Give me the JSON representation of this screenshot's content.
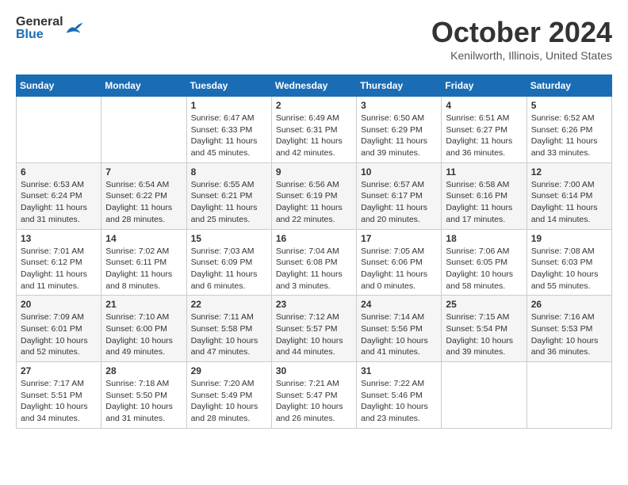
{
  "header": {
    "logo_general": "General",
    "logo_blue": "Blue",
    "month": "October 2024",
    "location": "Kenilworth, Illinois, United States"
  },
  "days_of_week": [
    "Sunday",
    "Monday",
    "Tuesday",
    "Wednesday",
    "Thursday",
    "Friday",
    "Saturday"
  ],
  "weeks": [
    [
      {
        "day": "",
        "sunrise": "",
        "sunset": "",
        "daylight": ""
      },
      {
        "day": "",
        "sunrise": "",
        "sunset": "",
        "daylight": ""
      },
      {
        "day": "1",
        "sunrise": "Sunrise: 6:47 AM",
        "sunset": "Sunset: 6:33 PM",
        "daylight": "Daylight: 11 hours and 45 minutes."
      },
      {
        "day": "2",
        "sunrise": "Sunrise: 6:49 AM",
        "sunset": "Sunset: 6:31 PM",
        "daylight": "Daylight: 11 hours and 42 minutes."
      },
      {
        "day": "3",
        "sunrise": "Sunrise: 6:50 AM",
        "sunset": "Sunset: 6:29 PM",
        "daylight": "Daylight: 11 hours and 39 minutes."
      },
      {
        "day": "4",
        "sunrise": "Sunrise: 6:51 AM",
        "sunset": "Sunset: 6:27 PM",
        "daylight": "Daylight: 11 hours and 36 minutes."
      },
      {
        "day": "5",
        "sunrise": "Sunrise: 6:52 AM",
        "sunset": "Sunset: 6:26 PM",
        "daylight": "Daylight: 11 hours and 33 minutes."
      }
    ],
    [
      {
        "day": "6",
        "sunrise": "Sunrise: 6:53 AM",
        "sunset": "Sunset: 6:24 PM",
        "daylight": "Daylight: 11 hours and 31 minutes."
      },
      {
        "day": "7",
        "sunrise": "Sunrise: 6:54 AM",
        "sunset": "Sunset: 6:22 PM",
        "daylight": "Daylight: 11 hours and 28 minutes."
      },
      {
        "day": "8",
        "sunrise": "Sunrise: 6:55 AM",
        "sunset": "Sunset: 6:21 PM",
        "daylight": "Daylight: 11 hours and 25 minutes."
      },
      {
        "day": "9",
        "sunrise": "Sunrise: 6:56 AM",
        "sunset": "Sunset: 6:19 PM",
        "daylight": "Daylight: 11 hours and 22 minutes."
      },
      {
        "day": "10",
        "sunrise": "Sunrise: 6:57 AM",
        "sunset": "Sunset: 6:17 PM",
        "daylight": "Daylight: 11 hours and 20 minutes."
      },
      {
        "day": "11",
        "sunrise": "Sunrise: 6:58 AM",
        "sunset": "Sunset: 6:16 PM",
        "daylight": "Daylight: 11 hours and 17 minutes."
      },
      {
        "day": "12",
        "sunrise": "Sunrise: 7:00 AM",
        "sunset": "Sunset: 6:14 PM",
        "daylight": "Daylight: 11 hours and 14 minutes."
      }
    ],
    [
      {
        "day": "13",
        "sunrise": "Sunrise: 7:01 AM",
        "sunset": "Sunset: 6:12 PM",
        "daylight": "Daylight: 11 hours and 11 minutes."
      },
      {
        "day": "14",
        "sunrise": "Sunrise: 7:02 AM",
        "sunset": "Sunset: 6:11 PM",
        "daylight": "Daylight: 11 hours and 8 minutes."
      },
      {
        "day": "15",
        "sunrise": "Sunrise: 7:03 AM",
        "sunset": "Sunset: 6:09 PM",
        "daylight": "Daylight: 11 hours and 6 minutes."
      },
      {
        "day": "16",
        "sunrise": "Sunrise: 7:04 AM",
        "sunset": "Sunset: 6:08 PM",
        "daylight": "Daylight: 11 hours and 3 minutes."
      },
      {
        "day": "17",
        "sunrise": "Sunrise: 7:05 AM",
        "sunset": "Sunset: 6:06 PM",
        "daylight": "Daylight: 11 hours and 0 minutes."
      },
      {
        "day": "18",
        "sunrise": "Sunrise: 7:06 AM",
        "sunset": "Sunset: 6:05 PM",
        "daylight": "Daylight: 10 hours and 58 minutes."
      },
      {
        "day": "19",
        "sunrise": "Sunrise: 7:08 AM",
        "sunset": "Sunset: 6:03 PM",
        "daylight": "Daylight: 10 hours and 55 minutes."
      }
    ],
    [
      {
        "day": "20",
        "sunrise": "Sunrise: 7:09 AM",
        "sunset": "Sunset: 6:01 PM",
        "daylight": "Daylight: 10 hours and 52 minutes."
      },
      {
        "day": "21",
        "sunrise": "Sunrise: 7:10 AM",
        "sunset": "Sunset: 6:00 PM",
        "daylight": "Daylight: 10 hours and 49 minutes."
      },
      {
        "day": "22",
        "sunrise": "Sunrise: 7:11 AM",
        "sunset": "Sunset: 5:58 PM",
        "daylight": "Daylight: 10 hours and 47 minutes."
      },
      {
        "day": "23",
        "sunrise": "Sunrise: 7:12 AM",
        "sunset": "Sunset: 5:57 PM",
        "daylight": "Daylight: 10 hours and 44 minutes."
      },
      {
        "day": "24",
        "sunrise": "Sunrise: 7:14 AM",
        "sunset": "Sunset: 5:56 PM",
        "daylight": "Daylight: 10 hours and 41 minutes."
      },
      {
        "day": "25",
        "sunrise": "Sunrise: 7:15 AM",
        "sunset": "Sunset: 5:54 PM",
        "daylight": "Daylight: 10 hours and 39 minutes."
      },
      {
        "day": "26",
        "sunrise": "Sunrise: 7:16 AM",
        "sunset": "Sunset: 5:53 PM",
        "daylight": "Daylight: 10 hours and 36 minutes."
      }
    ],
    [
      {
        "day": "27",
        "sunrise": "Sunrise: 7:17 AM",
        "sunset": "Sunset: 5:51 PM",
        "daylight": "Daylight: 10 hours and 34 minutes."
      },
      {
        "day": "28",
        "sunrise": "Sunrise: 7:18 AM",
        "sunset": "Sunset: 5:50 PM",
        "daylight": "Daylight: 10 hours and 31 minutes."
      },
      {
        "day": "29",
        "sunrise": "Sunrise: 7:20 AM",
        "sunset": "Sunset: 5:49 PM",
        "daylight": "Daylight: 10 hours and 28 minutes."
      },
      {
        "day": "30",
        "sunrise": "Sunrise: 7:21 AM",
        "sunset": "Sunset: 5:47 PM",
        "daylight": "Daylight: 10 hours and 26 minutes."
      },
      {
        "day": "31",
        "sunrise": "Sunrise: 7:22 AM",
        "sunset": "Sunset: 5:46 PM",
        "daylight": "Daylight: 10 hours and 23 minutes."
      },
      {
        "day": "",
        "sunrise": "",
        "sunset": "",
        "daylight": ""
      },
      {
        "day": "",
        "sunrise": "",
        "sunset": "",
        "daylight": ""
      }
    ]
  ]
}
